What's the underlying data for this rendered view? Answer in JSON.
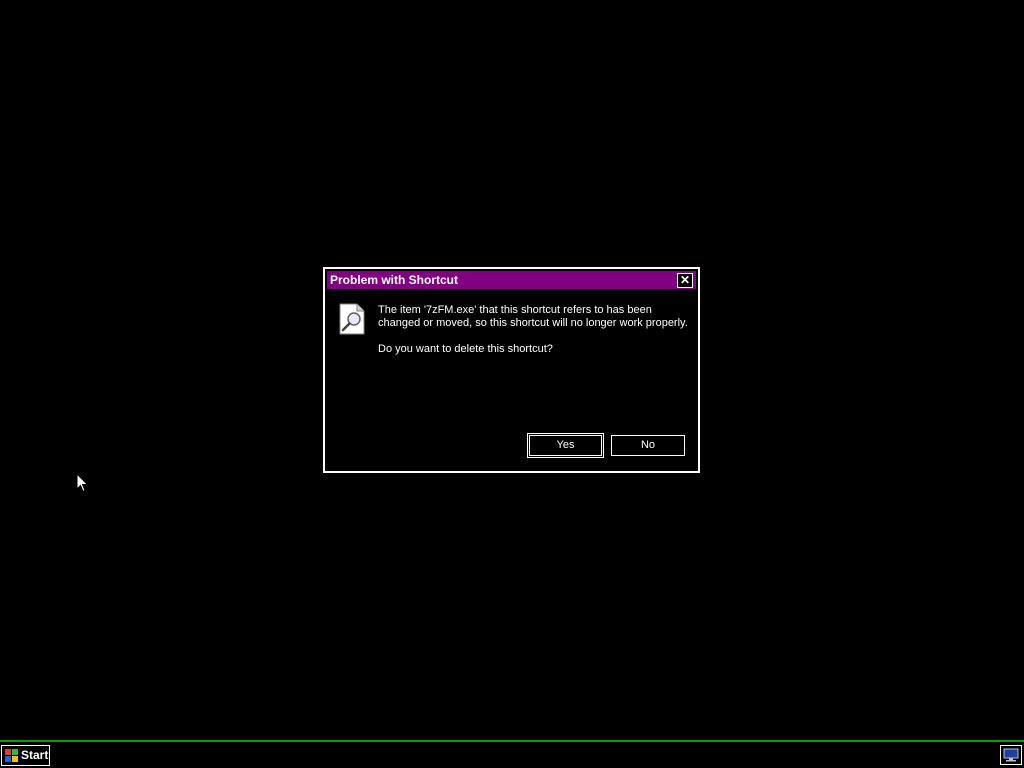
{
  "dialog": {
    "title": "Problem with Shortcut",
    "close_glyph": "✕",
    "icon": "document-search-icon",
    "message_line1": "The item '7zFM.exe' that this shortcut refers to has been changed or moved, so this shortcut will no longer work properly.",
    "message_line2": "Do you want to delete this shortcut?",
    "yes_label": "Yes",
    "no_label": "No"
  },
  "taskbar": {
    "start_label": "Start",
    "start_icon": "windows-logo-icon",
    "tray_icon": "monitor-icon"
  },
  "colors": {
    "desktop": "#000000",
    "titlebar": "#800080",
    "taskbar_border": "#00a000",
    "text": "#ffffff"
  }
}
